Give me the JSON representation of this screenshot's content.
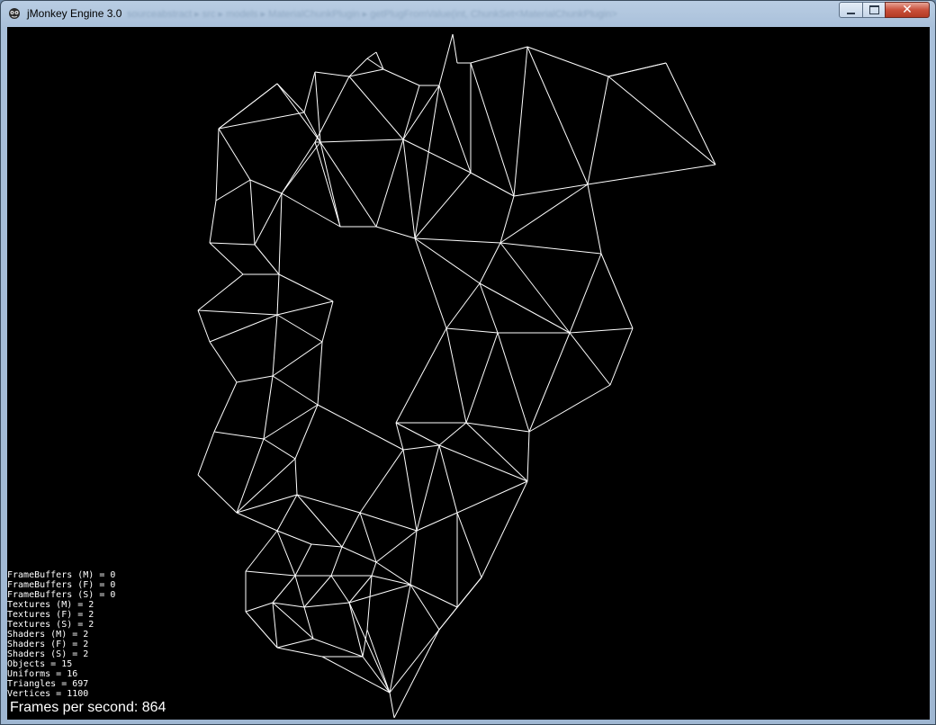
{
  "window": {
    "title": "jMonkey Engine 3.0",
    "background_tabs": "sourceabstract ▸  src ▸  models ▸  MaterialChunkPlugin ▸  getPlugFromValue(int, ChunkSet<MaterialChunkPlugin>",
    "controls": {
      "minimize_icon": "minimize-icon",
      "maximize_icon": "maximize-icon",
      "close_icon": "close-icon",
      "close_glyph": "✕"
    }
  },
  "scene": {
    "background": "#000000",
    "wire_color": "#ffffff",
    "description_icon": "wireframe-mesh"
  },
  "stats": {
    "lines": [
      "FrameBuffers (M) = 0",
      "FrameBuffers (F) = 0",
      "FrameBuffers (S) = 0",
      "Textures (M) = 2",
      "Textures (F) = 2",
      "Textures (S) = 2",
      "Shaders (M) = 2",
      "Shaders (F) = 2",
      "Shaders (S) = 2",
      "Objects = 15",
      "Uniforms = 16",
      "Triangles = 697",
      "Vertices = 1100"
    ],
    "fps_text": "Frames per second: 864"
  }
}
